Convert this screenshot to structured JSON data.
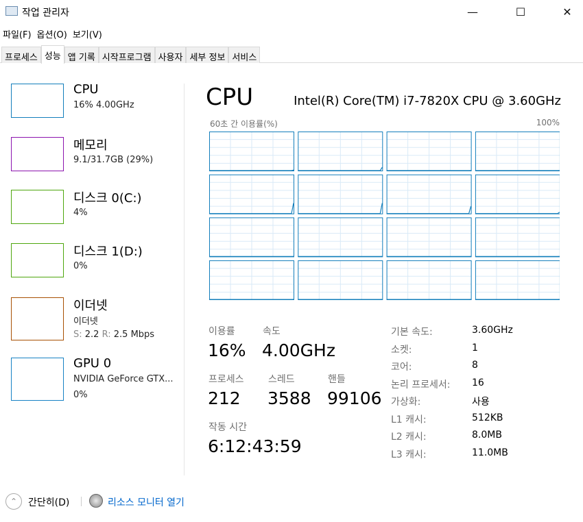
{
  "window": {
    "title": "작업 관리자",
    "icon": "task-manager-icon",
    "controls": [
      "minimize",
      "maximize",
      "close"
    ]
  },
  "menu": [
    "파일(F)",
    "옵션(O)",
    "보기(V)"
  ],
  "tabs": [
    {
      "label": "프로세스"
    },
    {
      "label": "성능",
      "active": true
    },
    {
      "label": "앱 기록"
    },
    {
      "label": "시작프로그램"
    },
    {
      "label": "사용자"
    },
    {
      "label": "세부 정보"
    },
    {
      "label": "서비스"
    }
  ],
  "sidebar": [
    {
      "name": "CPU",
      "sub1": "16%  4.00GHz",
      "color": "#117dbb"
    },
    {
      "name": "메모리",
      "sub1": "9.1/31.7GB (29%)",
      "color": "#8b12ae"
    },
    {
      "name": "디스크 0(C:)",
      "sub1": "4%",
      "color": "#4da60c"
    },
    {
      "name": "디스크 1(D:)",
      "sub1": "0%",
      "color": "#4da60c"
    },
    {
      "name": "이더넷",
      "sub1": "이더넷",
      "s_label": "S:",
      "s_val": "2.2",
      "r_label": "R:",
      "r_val": "2.5 Mbps",
      "color": "#a74f01"
    },
    {
      "name": "GPU 0",
      "sub1": "NVIDIA GeForce GTX...",
      "sub2": "0%",
      "color": "#1581c4"
    }
  ],
  "main": {
    "title": "CPU",
    "model": "Intel(R) Core(TM) i7-7820X CPU @ 3.60GHz",
    "graph_label": "60초 간 이용률(%)",
    "graph_max": "100%",
    "core_last_values": [
      3,
      10,
      2,
      2,
      28,
      28,
      20,
      5,
      2,
      2,
      2,
      2,
      2,
      2,
      2,
      2
    ],
    "stats": {
      "util_label": "이용률",
      "util": "16%",
      "speed_label": "속도",
      "speed": "4.00GHz",
      "proc_label": "프로세스",
      "proc": "212",
      "thread_label": "스레드",
      "thread": "3588",
      "handle_label": "핸들",
      "handle": "99106",
      "uptime_label": "작동 시간",
      "uptime": "6:12:43:59"
    },
    "details": [
      {
        "k": "기본 속도:",
        "v": "3.60GHz"
      },
      {
        "k": "소켓:",
        "v": "1"
      },
      {
        "k": "코어:",
        "v": "8"
      },
      {
        "k": "논리 프로세서:",
        "v": "16"
      },
      {
        "k": "가상화:",
        "v": "사용"
      },
      {
        "k": "L1 캐시:",
        "v": "512KB"
      },
      {
        "k": "L2 캐시:",
        "v": "8.0MB"
      },
      {
        "k": "L3 캐시:",
        "v": "11.0MB"
      }
    ]
  },
  "footer": {
    "less_details": "간단히(D)",
    "resource_monitor": "리소스 모니터 열기"
  }
}
